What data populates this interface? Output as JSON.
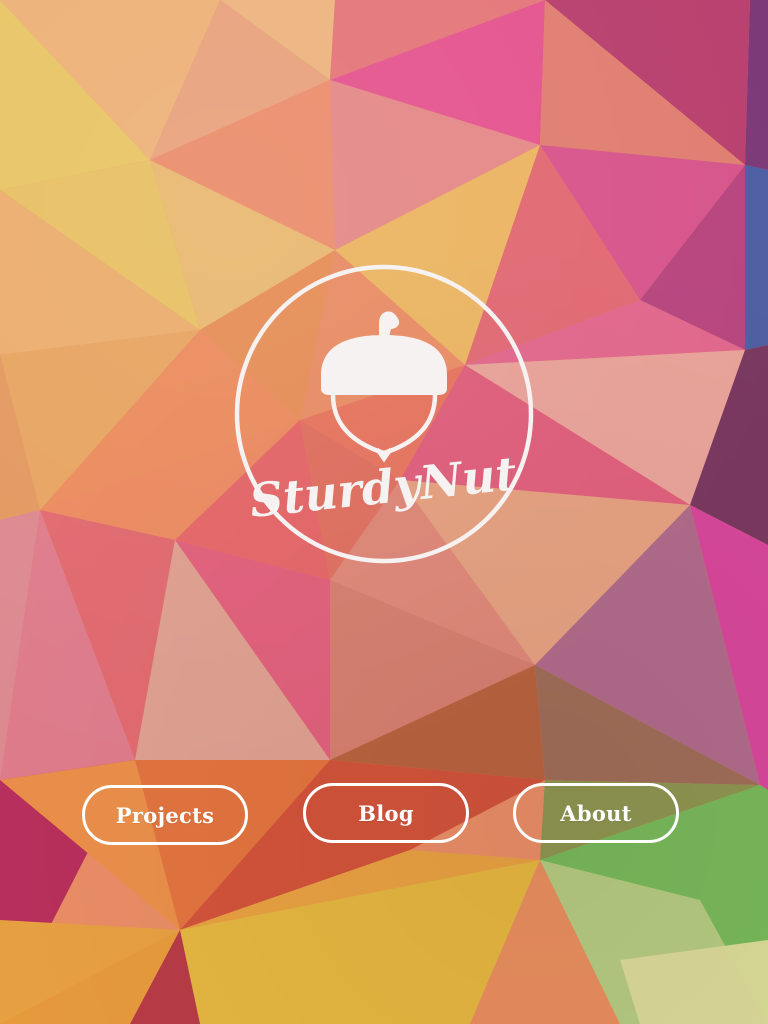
{
  "brand": {
    "name": "SturdyNut",
    "logo_icon": "acorn-icon",
    "logo_color": "#f7f2f2"
  },
  "nav": {
    "items": [
      {
        "label": "Projects"
      },
      {
        "label": "Blog"
      },
      {
        "label": "About"
      }
    ]
  },
  "theme": {
    "button_border": "#ffffff",
    "button_text": "#ffffff"
  }
}
